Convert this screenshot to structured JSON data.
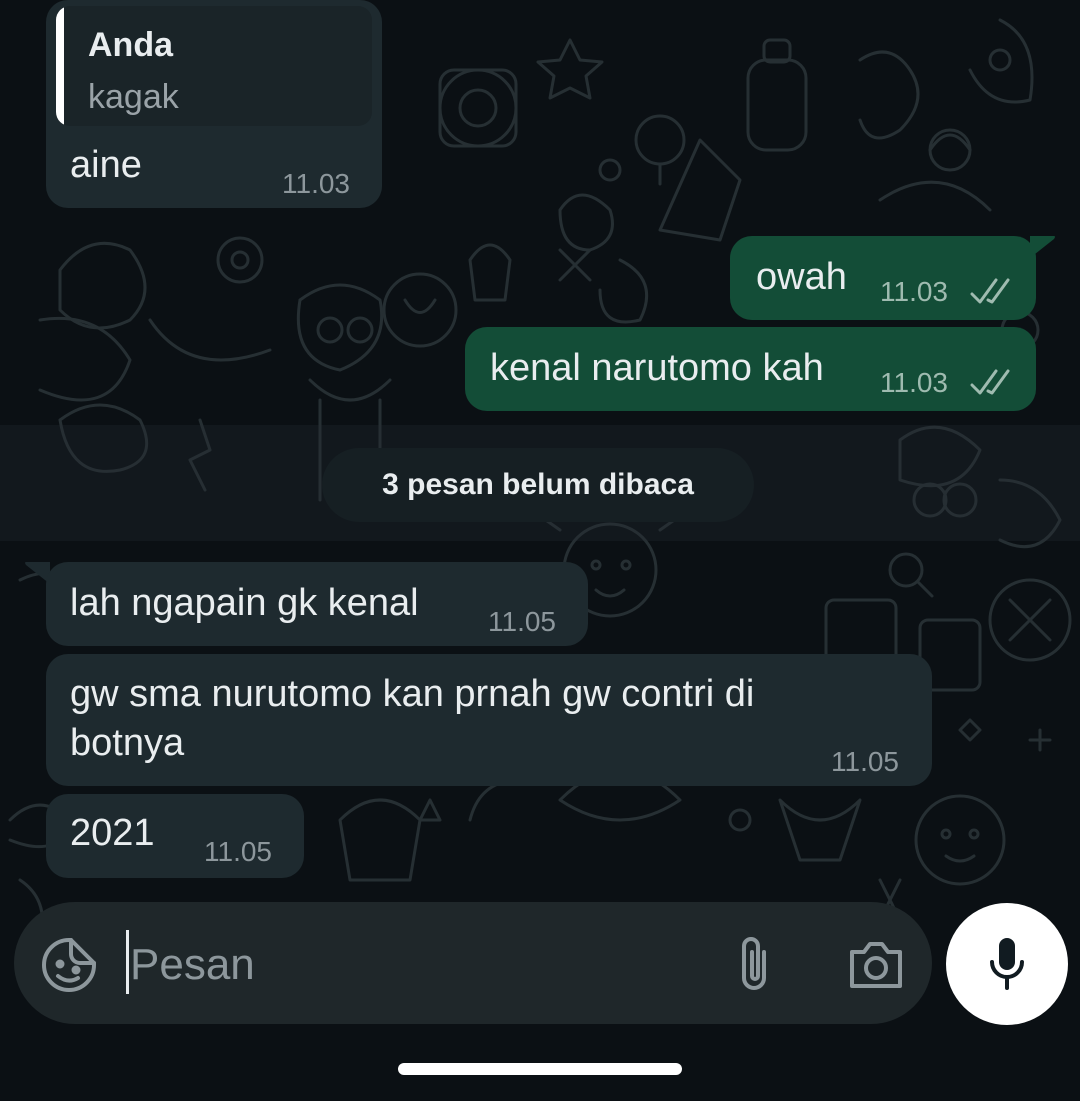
{
  "colors": {
    "background": "#0b1014",
    "incoming_bubble": "#1e2a2f",
    "outgoing_bubble": "#134d37",
    "text": "#e9edef",
    "meta_text": "#8d979c",
    "composer": "#1f272a",
    "mic_button": "#ffffff"
  },
  "messages": [
    {
      "direction": "incoming",
      "reply": {
        "author": "Anda",
        "text": "kagak"
      },
      "text": "aine",
      "time": "11.03"
    },
    {
      "direction": "outgoing",
      "text": "owah",
      "time": "11.03",
      "status": "double-check-icon"
    },
    {
      "direction": "outgoing",
      "text": "kenal narutomo kah",
      "time": "11.03",
      "status": "double-check-icon"
    },
    {
      "direction": "incoming",
      "text": "lah ngapain gk kenal",
      "time": "11.05"
    },
    {
      "direction": "incoming",
      "text_lines": [
        "gw sma nurutomo kan prnah gw contri di",
        "botnya"
      ],
      "time": "11.05"
    },
    {
      "direction": "incoming",
      "text": "2021",
      "time": "11.05"
    }
  ],
  "unread_divider": {
    "label": "3 pesan belum dibaca"
  },
  "composer": {
    "placeholder": "Pesan",
    "value": "",
    "icons": [
      "sticker-icon",
      "attach-icon",
      "camera-icon"
    ],
    "send_button_icon": "mic-icon"
  }
}
